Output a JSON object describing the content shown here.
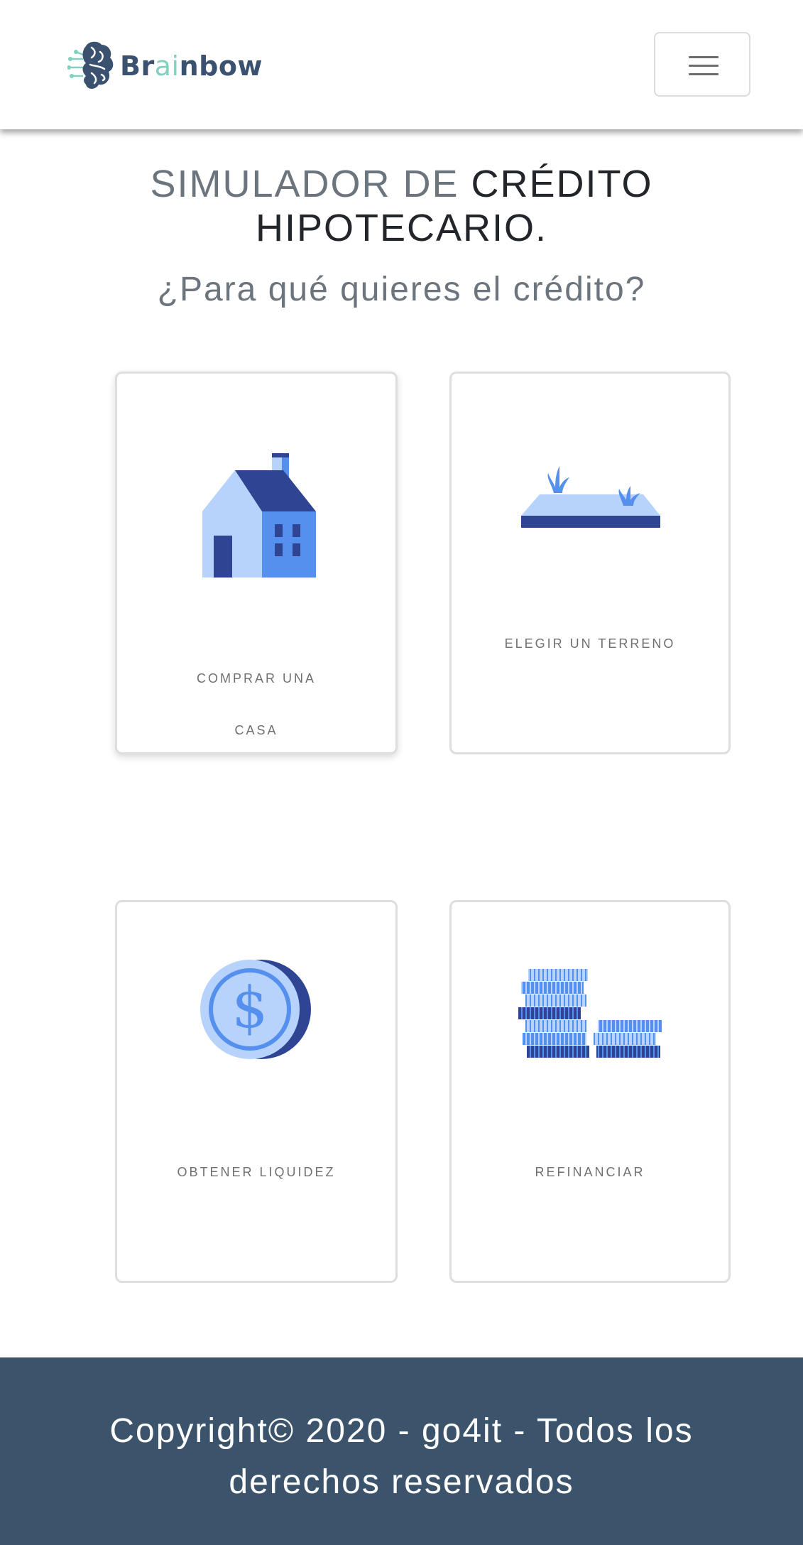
{
  "navbar": {
    "brand": {
      "part1": "Br",
      "part2": "ai",
      "part3": "nbow"
    },
    "menu_toggle_icon": "hamburger-icon"
  },
  "header": {
    "title_muted": "SIMULADOR DE",
    "title_main": "CRÉDITO HIPOTECARIO.",
    "subtitle": "¿Para qué quieres el crédito?"
  },
  "options": [
    {
      "line1": "COMPRAR UNA",
      "line2": "CASA",
      "icon": "house-icon"
    },
    {
      "label": "ELEGIR UN TERRENO",
      "icon": "land-plot-icon"
    },
    {
      "label": "OBTENER LIQUIDEZ",
      "icon": "coin-icon"
    },
    {
      "label": "REFINANCIAR",
      "icon": "coin-stacks-icon"
    }
  ],
  "colors": {
    "dark_blue": "#2f4593",
    "mid_blue": "#5590ee",
    "light_blue": "#b7d3fb",
    "footer_bg": "#3c536c"
  },
  "footer": {
    "copyright": "Copyright© 2020 - go4it - Todos los derechos reservados"
  }
}
